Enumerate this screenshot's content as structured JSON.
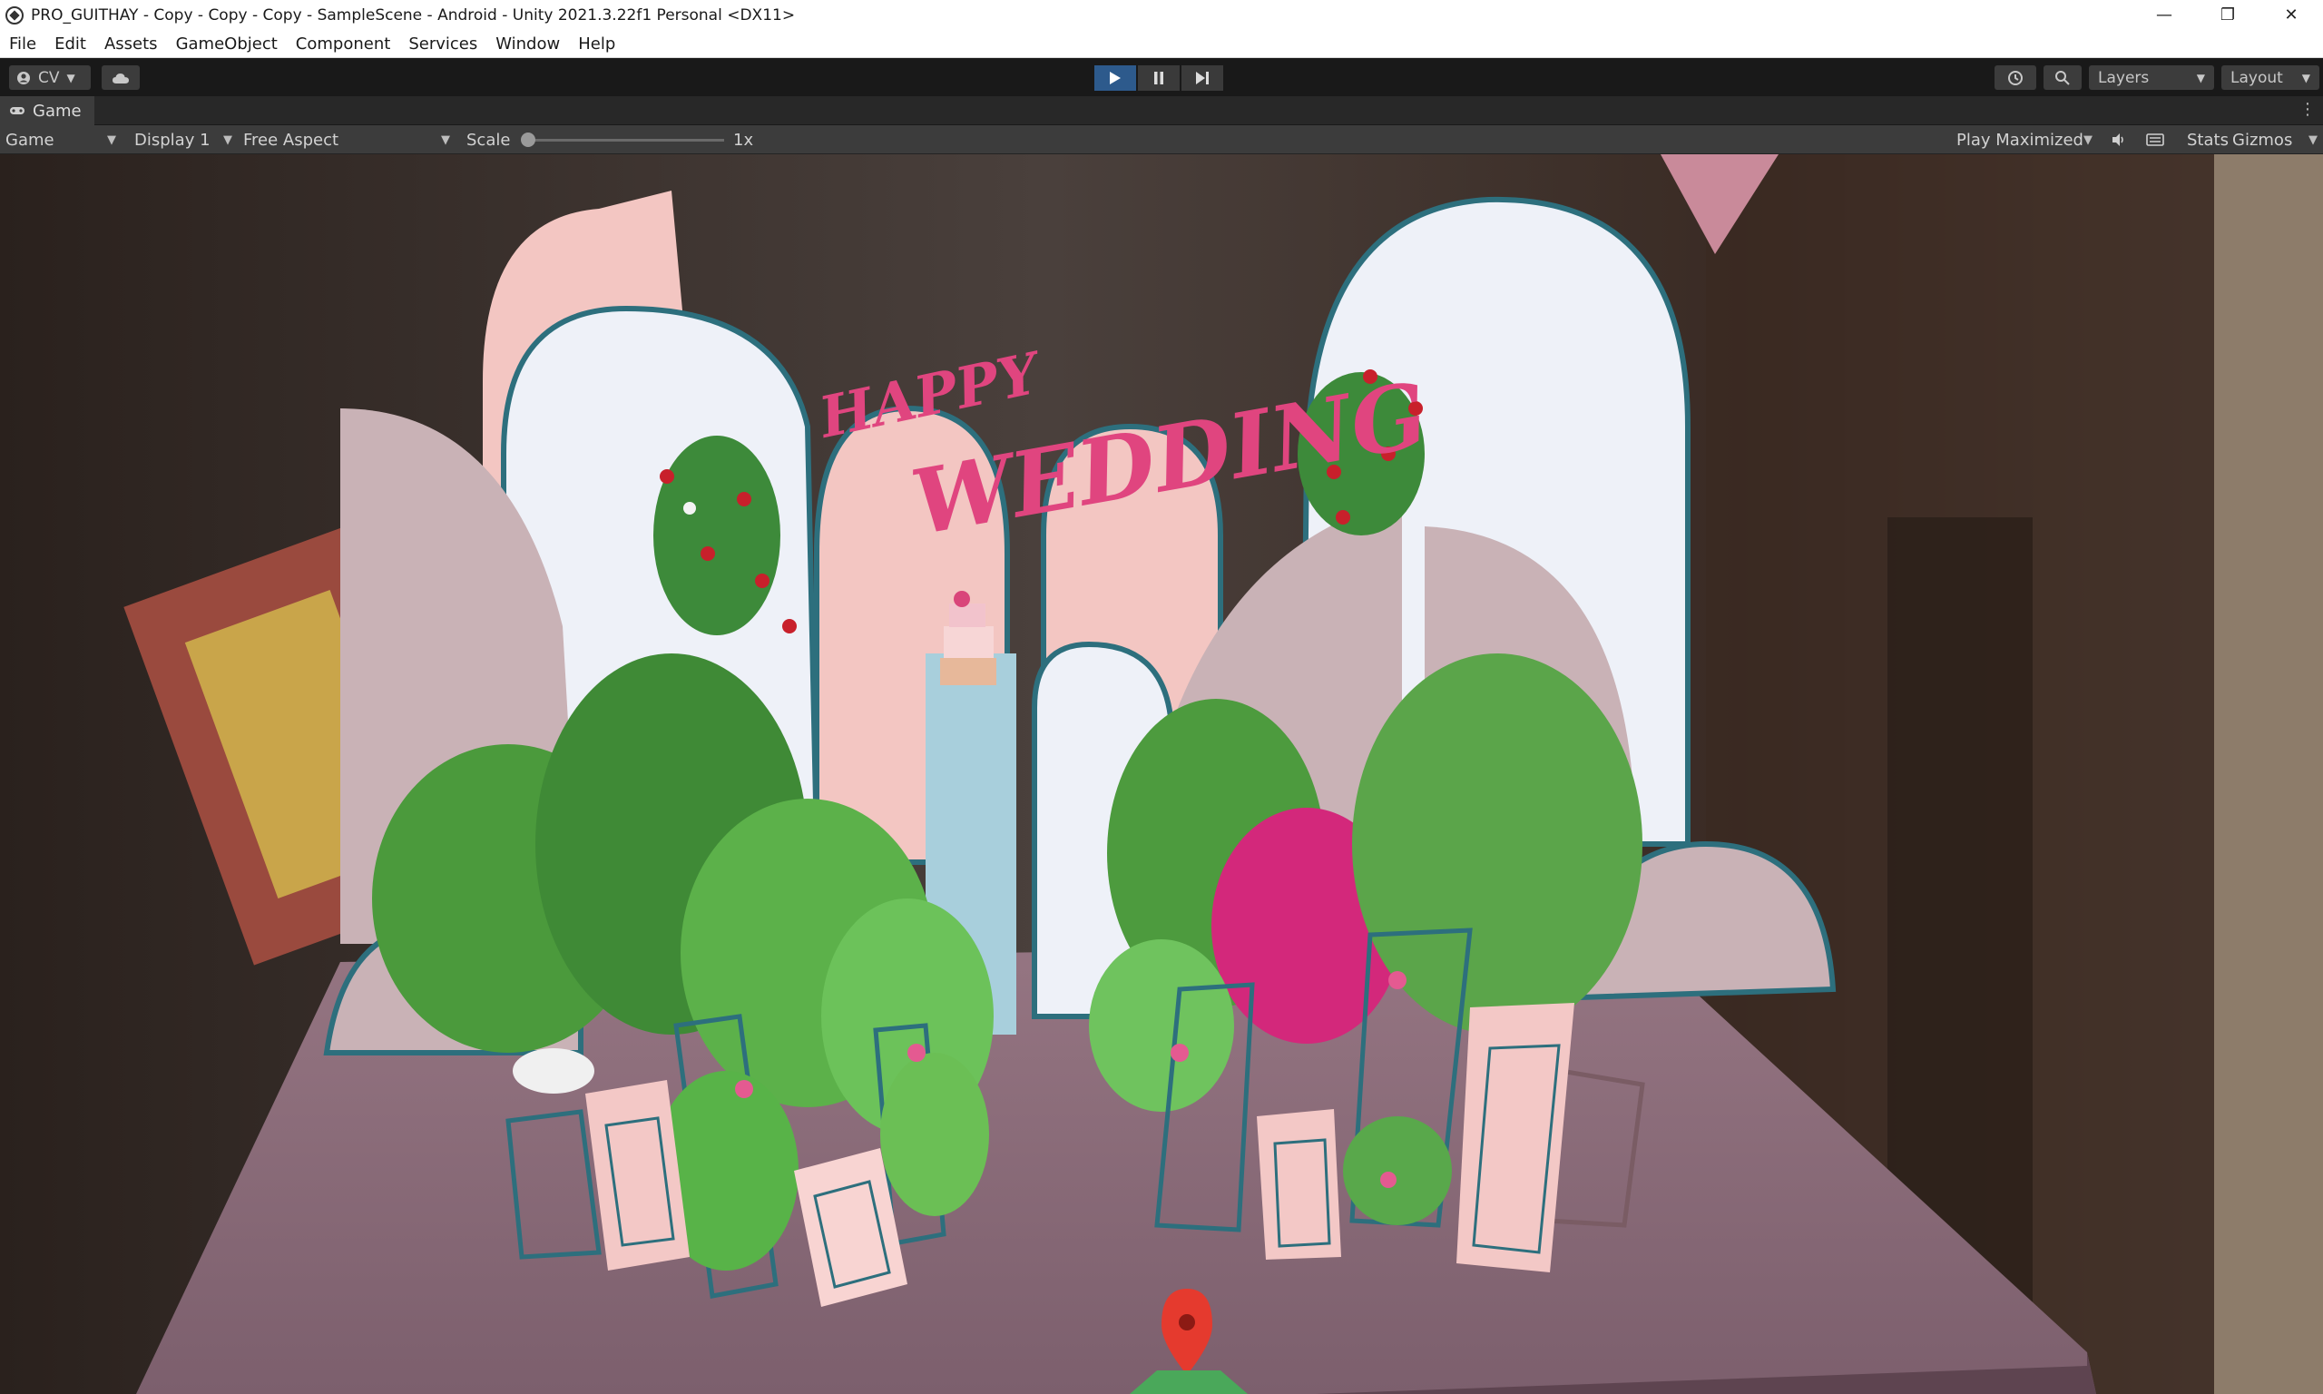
{
  "window": {
    "title": "PRO_GUITHAY - Copy - Copy - Copy - SampleScene - Android - Unity 2021.3.22f1 Personal <DX11>",
    "controls": {
      "minimize": "—",
      "restore": "❐",
      "close": "✕"
    }
  },
  "menu": [
    "File",
    "Edit",
    "Assets",
    "GameObject",
    "Component",
    "Services",
    "Window",
    "Help"
  ],
  "toolbar": {
    "account_label": "CV",
    "layers_label": "Layers",
    "layout_label": "Layout",
    "play_state": "playing"
  },
  "tab": {
    "label": "Game"
  },
  "game_view": {
    "mode": "Game",
    "display": "Display 1",
    "aspect": "Free Aspect",
    "scale_label": "Scale",
    "scale_value": "1x",
    "scale_fraction": 0.0,
    "play_mode": "Play Maximized",
    "stats_label": "Stats",
    "gizmos_label": "Gizmos"
  },
  "scene": {
    "headline_line1": "HAPPY",
    "headline_line2": "WEDDING",
    "colors": {
      "text_pink": "#e0457f",
      "arch_pink": "#f3c6c2",
      "arch_white": "#eef1f8",
      "arch_mauve": "#c9b2b6",
      "arch_outline": "#2d6f7d",
      "table_top": "#8c6d7a",
      "pedestal_blue": "#a8cfdc"
    },
    "icons": [
      "map-pin-icon"
    ]
  }
}
